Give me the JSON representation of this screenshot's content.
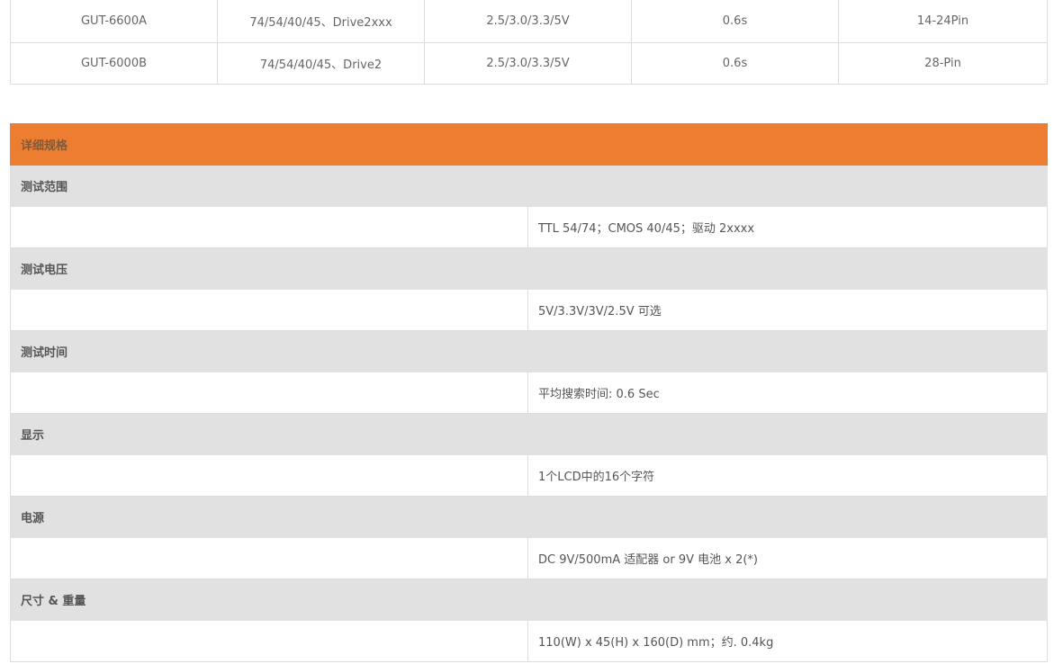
{
  "models": {
    "rows": [
      [
        "GUT-6600A",
        "74/54/40/45、Drive2xxx",
        "2.5/3.0/3.3/5V",
        "0.6s",
        "14-24Pin"
      ],
      [
        "GUT-6000B",
        "74/54/40/45、Drive2",
        "2.5/3.0/3.3/5V",
        "0.6s",
        "28-Pin"
      ]
    ]
  },
  "spec": {
    "header": "详细规格",
    "sections": [
      {
        "title": "测试范围",
        "value": "TTL 54/74；CMOS 40/45；驱动 2xxxx"
      },
      {
        "title": "测试电压",
        "value": "5V/3.3V/3V/2.5V 可选"
      },
      {
        "title": "测试时间",
        "value": "平均搜索时间: 0.6 Sec"
      },
      {
        "title": "显示",
        "value": "1个LCD中的16个字符"
      },
      {
        "title": "电源",
        "value": "DC 9V/500mA 适配器 or 9V 电池 x 2(*)"
      },
      {
        "title": "尺寸 & 重量",
        "value": "110(W) x 45(H) x 160(D) mm；约. 0.4kg"
      }
    ]
  }
}
